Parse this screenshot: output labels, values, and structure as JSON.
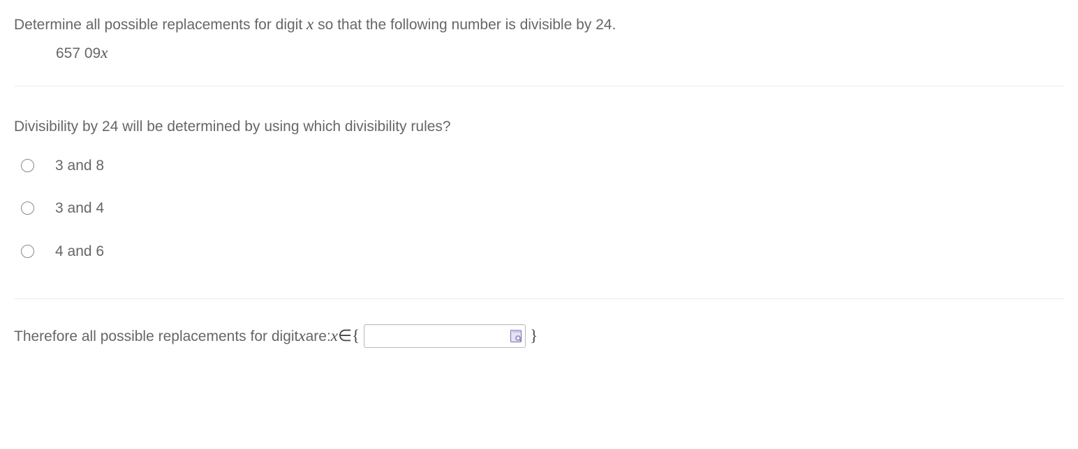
{
  "problem": {
    "prompt_pre": "Determine all possible replacements for digit ",
    "var": "x",
    "prompt_post": " so that the following number is divisible by 24.",
    "number_pre": "657 09",
    "number_var": "x"
  },
  "question": {
    "text": "Divisibility by 24 will be determined by using which divisibility rules?",
    "options": [
      {
        "label": "3 and 8"
      },
      {
        "label": "3 and 4"
      },
      {
        "label": "4 and 6"
      }
    ]
  },
  "answer": {
    "pre": "Therefore all possible replacements for digit ",
    "var": "x",
    "mid": " are:  ",
    "set_var": "x",
    "elem": " ∈{",
    "input_value": "",
    "close_brace": "}"
  }
}
